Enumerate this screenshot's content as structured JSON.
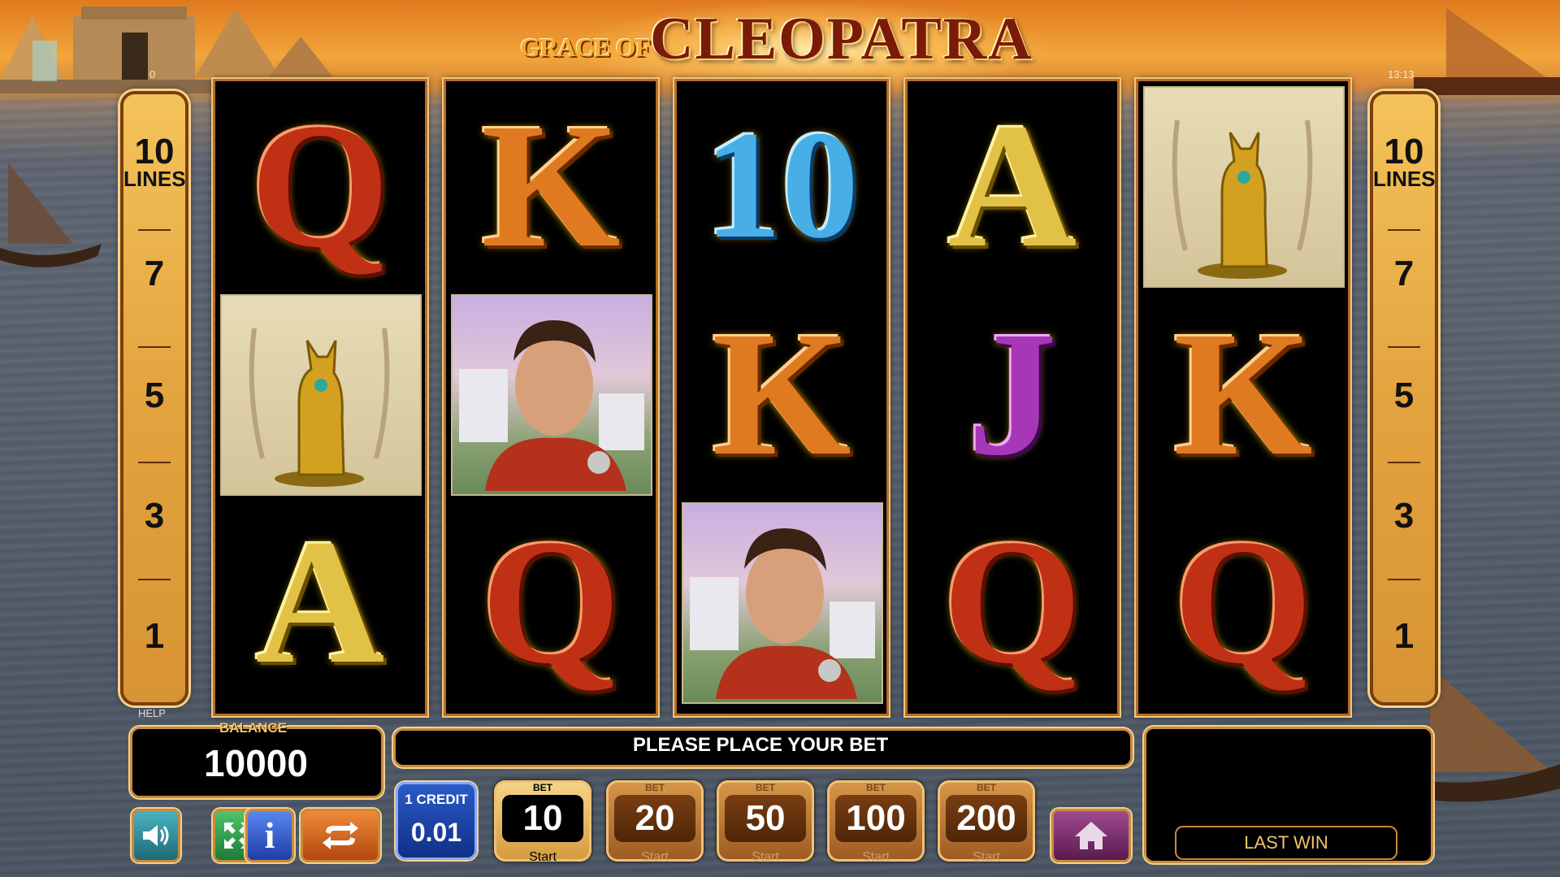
{
  "game": {
    "title_small": "GRACE OF",
    "title_big": "CLEOPATRA",
    "counter_left": "0",
    "clock": "13:13",
    "help_label": "HELP"
  },
  "paylines": {
    "max_value": "10",
    "max_label": "LINES",
    "options": [
      "7",
      "5",
      "3",
      "1"
    ]
  },
  "reels": [
    [
      "Q",
      "cat",
      "A"
    ],
    [
      "K",
      "man",
      "Q"
    ],
    [
      "10",
      "K",
      "man"
    ],
    [
      "A",
      "J",
      "Q"
    ],
    [
      "cat",
      "K",
      "Q"
    ]
  ],
  "balance": {
    "label": "BALANCE",
    "value": "10000"
  },
  "message": "PLEASE PLACE YOUR BET",
  "credit": {
    "label": "1 CREDIT",
    "value": "0.01"
  },
  "bets": {
    "top_label": "BET",
    "start_label": "Start",
    "options": [
      "10",
      "20",
      "50",
      "100",
      "200"
    ],
    "selected": "10"
  },
  "last_win": {
    "label": "LAST WIN"
  },
  "controls": {
    "icons": [
      "speaker-icon",
      "fullscreen-icon",
      "info-icon",
      "autoplay-icon",
      "home-icon"
    ]
  },
  "colors": {
    "accent_gold": "#f3d190",
    "credit_blue": "#1f4fb8",
    "speaker_teal": "#2f8a96",
    "fullscreen_green": "#2e9a4a",
    "info_blue": "#2a56c6",
    "autoplay_orange": "#e06a1a",
    "home_purple": "#7a2a6a"
  }
}
